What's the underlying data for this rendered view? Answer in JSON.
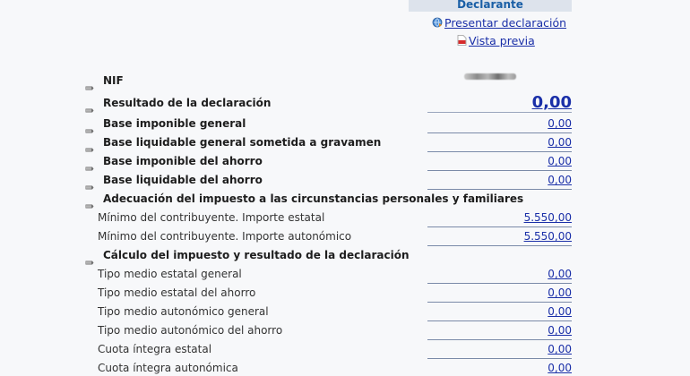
{
  "header": {
    "tab_label": "Declarante"
  },
  "actions": {
    "presentar": "Presentar declaración",
    "vista_previa": "Vista previa"
  },
  "nif": {
    "label": "NIF"
  },
  "rows": [
    {
      "label": "Resultado de la declaración",
      "value": "0,00"
    },
    {
      "label": "Base imponible general",
      "value": "0,00"
    },
    {
      "label": "Base liquidable general sometida a gravamen",
      "value": "0,00"
    },
    {
      "label": "Base imponible del ahorro",
      "value": "0,00"
    },
    {
      "label": "Base liquidable del ahorro",
      "value": "0,00"
    },
    {
      "label": "Adecuación del impuesto a las circunstancias personales y familiares"
    },
    {
      "label": "Mínimo del contribuyente. Importe estatal",
      "value": "5.550,00"
    },
    {
      "label": "Mínimo del contribuyente. Importe autonómico",
      "value": "5.550,00"
    },
    {
      "label": "Cálculo del impuesto y resultado de la declaración"
    },
    {
      "label": "Tipo medio estatal general",
      "value": "0,00"
    },
    {
      "label": "Tipo medio estatal del ahorro",
      "value": "0,00"
    },
    {
      "label": "Tipo medio autonómico general",
      "value": "0,00"
    },
    {
      "label": "Tipo medio autonómico del ahorro",
      "value": "0,00"
    },
    {
      "label": "Cuota íntegra estatal",
      "value": "0,00"
    },
    {
      "label": "Cuota íntegra autonómica",
      "value": "0,00"
    }
  ]
}
